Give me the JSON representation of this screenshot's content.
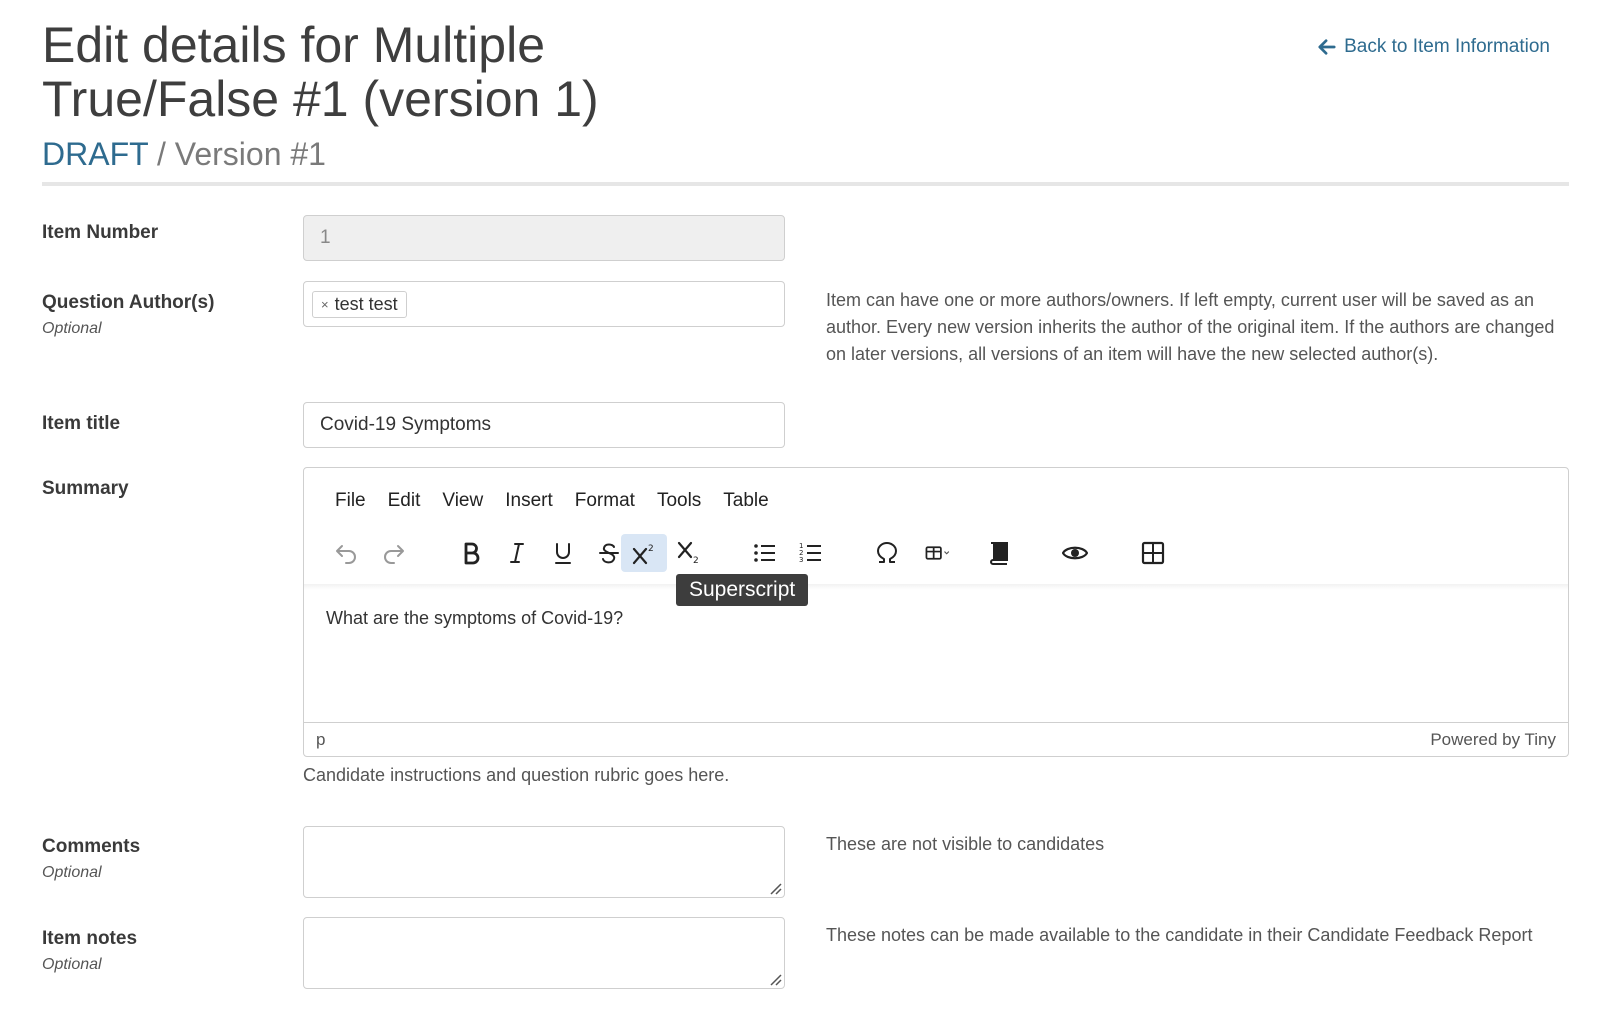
{
  "header": {
    "title": "Edit details for Multiple True/False #1 (version 1)",
    "status": "DRAFT",
    "separator": "/",
    "version": "Version #1",
    "back_link": "Back to Item Information"
  },
  "colors": {
    "accent": "#2e6b8f",
    "active_button": "#d9e6f5",
    "tooltip_bg": "#3d3d3d"
  },
  "fields": {
    "item_number": {
      "label": "Item Number",
      "value": "1"
    },
    "authors": {
      "label": "Question Author(s)",
      "optional": "Optional",
      "tags": [
        {
          "label": "test test",
          "remove": "×"
        }
      ],
      "help": "Item can have one or more authors/owners. If left empty, current user will be saved as an author. Every new version inherits the author of the original item. If the authors are changed on later versions, all versions of an item will have the new selected author(s)."
    },
    "item_title": {
      "label": "Item title",
      "value": "Covid-19 Symptoms"
    },
    "summary": {
      "label": "Summary",
      "menu": [
        "File",
        "Edit",
        "View",
        "Insert",
        "Format",
        "Tools",
        "Table"
      ],
      "toolbar_icons": [
        "undo-icon",
        "redo-icon",
        "bold-icon",
        "italic-icon",
        "underline-icon",
        "strikethrough-icon",
        "superscript-icon",
        "subscript-icon",
        "bullet-list-icon",
        "numbered-list-icon",
        "special-character-icon",
        "table-icon",
        "book-icon",
        "preview-icon",
        "layout-icon"
      ],
      "content": "What are the symptoms of Covid-19?",
      "status_path": "p",
      "powered_by": "Powered by Tiny",
      "tooltip": "Superscript",
      "help": "Candidate instructions and question rubric goes here."
    },
    "comments": {
      "label": "Comments",
      "optional": "Optional",
      "help": "These are not visible to candidates"
    },
    "item_notes": {
      "label": "Item notes",
      "optional": "Optional",
      "help": "These notes can be made available to the candidate in their Candidate Feedback Report"
    }
  }
}
